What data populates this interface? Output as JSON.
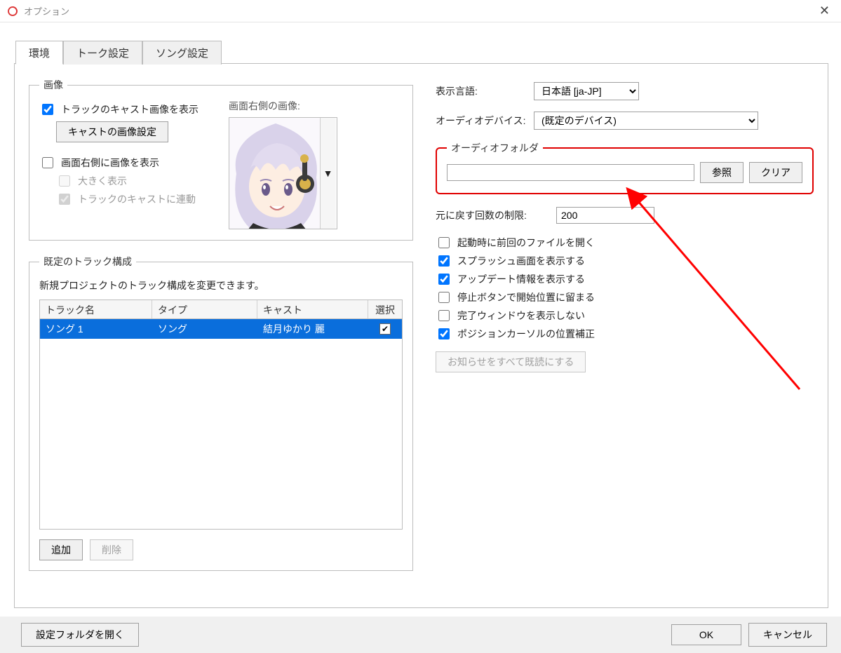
{
  "window": {
    "title": "オプション"
  },
  "tabs": {
    "env": "環境",
    "talk": "トーク設定",
    "song": "ソング設定"
  },
  "image_group": {
    "legend": "画像",
    "show_track_cast": "トラックのキャスト画像を表示",
    "cast_image_settings_btn": "キャストの画像設定",
    "show_right_image": "画面右側に画像を表示",
    "large_display": "大きく表示",
    "link_track_cast": "トラックのキャストに連動",
    "right_image_label": "画面右側の画像:"
  },
  "tracks_group": {
    "legend": "既定のトラック構成",
    "description": "新規プロジェクトのトラック構成を変更できます。",
    "columns": {
      "name": "トラック名",
      "type": "タイプ",
      "cast": "キャスト",
      "select": "選択"
    },
    "rows": [
      {
        "name": "ソング 1",
        "type": "ソング",
        "cast": "結月ゆかり 麗",
        "selected": true
      }
    ],
    "add_btn": "追加",
    "delete_btn": "削除"
  },
  "right": {
    "lang_label": "表示言語:",
    "lang_value": "日本語 [ja-JP]",
    "audio_device_label": "オーディオデバイス:",
    "audio_device_value": "(既定のデバイス)",
    "audio_folder_legend": "オーディオフォルダ",
    "audio_folder_value": "",
    "browse_btn": "参照",
    "clear_btn": "クリア",
    "undo_limit_label": "元に戻す回数の制限:",
    "undo_limit_value": "200",
    "chk_open_last": "起動時に前回のファイルを開く",
    "chk_splash": "スプラッシュ画面を表示する",
    "chk_update": "アップデート情報を表示する",
    "chk_stop_stay": "停止ボタンで開始位置に留まる",
    "chk_no_complete": "完了ウィンドウを表示しない",
    "chk_pos_cursor": "ポジションカーソルの位置補正",
    "mark_read_btn": "お知らせをすべて既読にする"
  },
  "footer": {
    "open_settings_folder": "設定フォルダを開く",
    "ok": "OK",
    "cancel": "キャンセル"
  }
}
